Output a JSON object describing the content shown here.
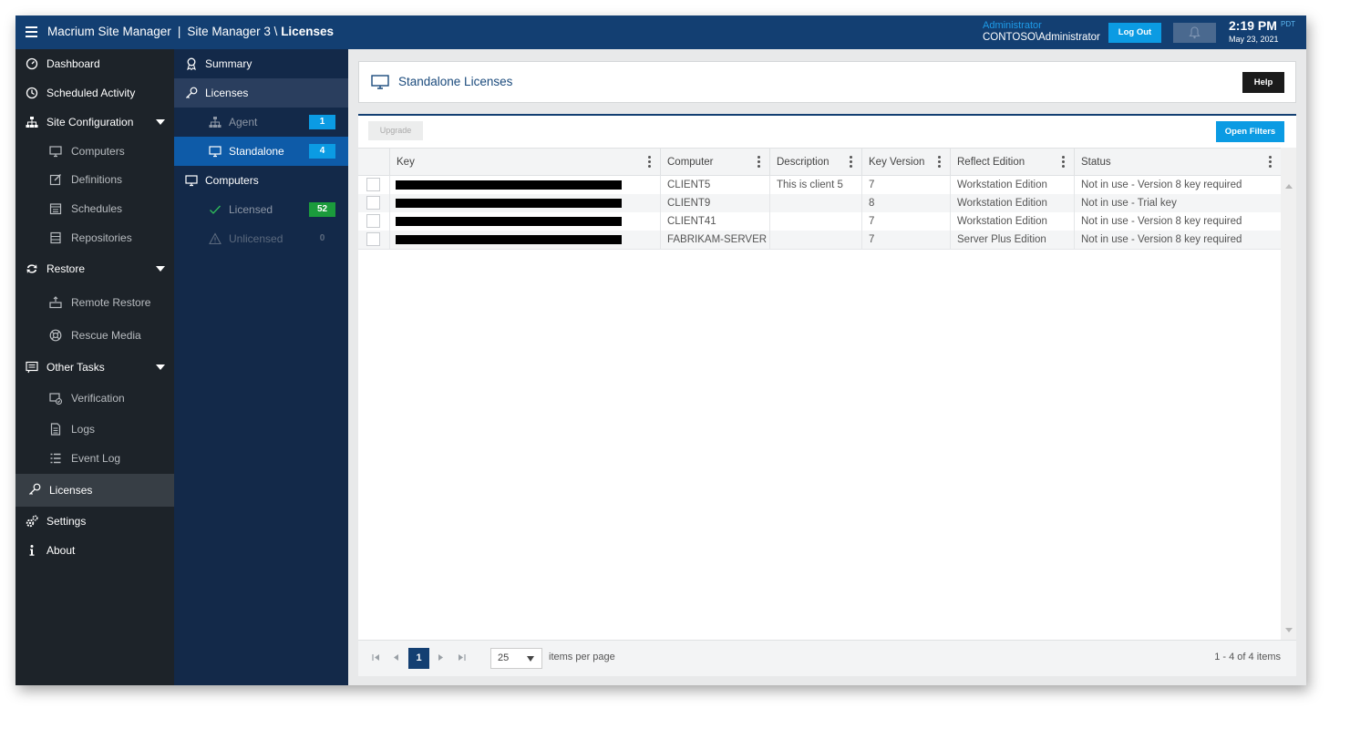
{
  "header": {
    "app_name": "Macrium Site Manager",
    "separator": "|",
    "site": "Site Manager 3",
    "path_sep": "\\",
    "section": "Licenses",
    "user_role": "Administrator",
    "user_name": "CONTOSO\\Administrator",
    "logout_label": "Log Out",
    "time": "2:19 PM",
    "timezone": "PDT",
    "date": "May 23, 2021"
  },
  "sidebar": {
    "items": [
      {
        "label": "Dashboard",
        "icon": "dashboard-icon"
      },
      {
        "label": "Scheduled Activity",
        "icon": "clock-icon"
      },
      {
        "label": "Site Configuration",
        "icon": "sitemap-icon"
      },
      {
        "label": "Computers",
        "icon": "monitor-icon"
      },
      {
        "label": "Definitions",
        "icon": "edit-icon"
      },
      {
        "label": "Schedules",
        "icon": "calendar-icon"
      },
      {
        "label": "Repositories",
        "icon": "database-icon"
      },
      {
        "label": "Restore",
        "icon": "restore-icon"
      },
      {
        "label": "Remote Restore",
        "icon": "remote-restore-icon"
      },
      {
        "label": "Rescue Media",
        "icon": "lifebuoy-icon"
      },
      {
        "label": "Other Tasks",
        "icon": "tasks-icon"
      },
      {
        "label": "Verification",
        "icon": "verify-icon"
      },
      {
        "label": "Logs",
        "icon": "document-icon"
      },
      {
        "label": "Event Log",
        "icon": "list-icon"
      },
      {
        "label": "Licenses",
        "icon": "key-icon"
      },
      {
        "label": "Settings",
        "icon": "cogs-icon"
      },
      {
        "label": "About",
        "icon": "info-icon"
      }
    ]
  },
  "panel": {
    "items": [
      {
        "label": "Summary",
        "icon": "ribbon-icon"
      },
      {
        "label": "Licenses",
        "icon": "key-icon"
      },
      {
        "label": "Agent",
        "icon": "sitemap-icon",
        "badge": "1"
      },
      {
        "label": "Standalone",
        "icon": "monitor-icon",
        "badge": "4"
      },
      {
        "label": "Computers",
        "icon": "monitor-icon"
      },
      {
        "label": "Licensed",
        "icon": "check-icon",
        "badge": "52"
      },
      {
        "label": "Unlicensed",
        "icon": "warning-icon",
        "badge": "0"
      }
    ]
  },
  "main": {
    "title": "Standalone Licenses",
    "help_label": "Help",
    "upgrade_label": "Upgrade",
    "filters_label": "Open Filters",
    "columns": [
      "Key",
      "Computer",
      "Description",
      "Key Version",
      "Reflect Edition",
      "Status"
    ],
    "rows": [
      {
        "key": "",
        "computer": "CLIENT5",
        "description": "This is client 5",
        "key_version": "7",
        "edition": "Workstation Edition",
        "status": "Not in use - Version 8 key required"
      },
      {
        "key": "",
        "computer": "CLIENT9",
        "description": "",
        "key_version": "8",
        "edition": "Workstation Edition",
        "status": "Not in use - Trial key"
      },
      {
        "key": "",
        "computer": "CLIENT41",
        "description": "",
        "key_version": "7",
        "edition": "Workstation Edition",
        "status": "Not in use - Version 8 key required"
      },
      {
        "key": "",
        "computer": "FABRIKAM-SERVER",
        "description": "",
        "key_version": "7",
        "edition": "Server Plus Edition",
        "status": "Not in use - Version 8 key required"
      }
    ],
    "pager": {
      "current_page": "1",
      "page_size": "25",
      "page_size_label": "items per page",
      "info": "1 - 4 of 4 items"
    }
  },
  "colors": {
    "topbar": "#133f72",
    "sidebar": "#1d2329",
    "panel": "#132949",
    "accent": "#0b9be3",
    "licensed_badge": "#1b9b3c"
  }
}
